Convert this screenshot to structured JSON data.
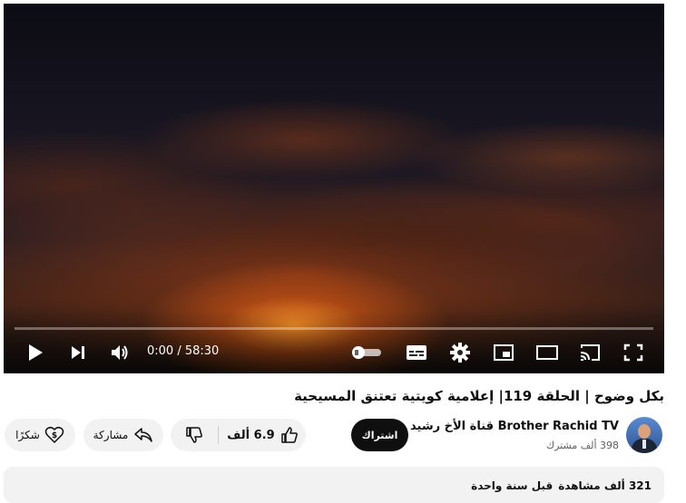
{
  "player": {
    "time": "0:00 / 58:30",
    "progress_fraction": 0.0
  },
  "video": {
    "title": "بكل وضوح | الحلقة 119| إعلامية كويتية تعتنق المسيحية"
  },
  "channel": {
    "name": "Brother Rachid TV قناة الأخ رشيد",
    "subscribers": "398 ألف مشترك",
    "subscribe_label": "اشتراك"
  },
  "actions": {
    "like_count": "6.9 ألف",
    "share_label": "مشاركة",
    "thanks_label": "شكرًا"
  },
  "description": {
    "views": "321 ألف مشاهدة",
    "published": "قبل سنة واحدة"
  },
  "colors": {
    "progress": "#ff0000",
    "subscribe_bg": "#0f0f0f",
    "pill_bg": "#f2f2f2"
  },
  "icons": [
    "play-icon",
    "next-icon",
    "volume-icon",
    "autoplay-toggle-icon",
    "subtitles-icon",
    "settings-icon",
    "miniplayer-icon",
    "theater-icon",
    "cast-icon",
    "fullscreen-icon",
    "like-icon",
    "dislike-icon",
    "share-icon",
    "thanks-icon"
  ]
}
